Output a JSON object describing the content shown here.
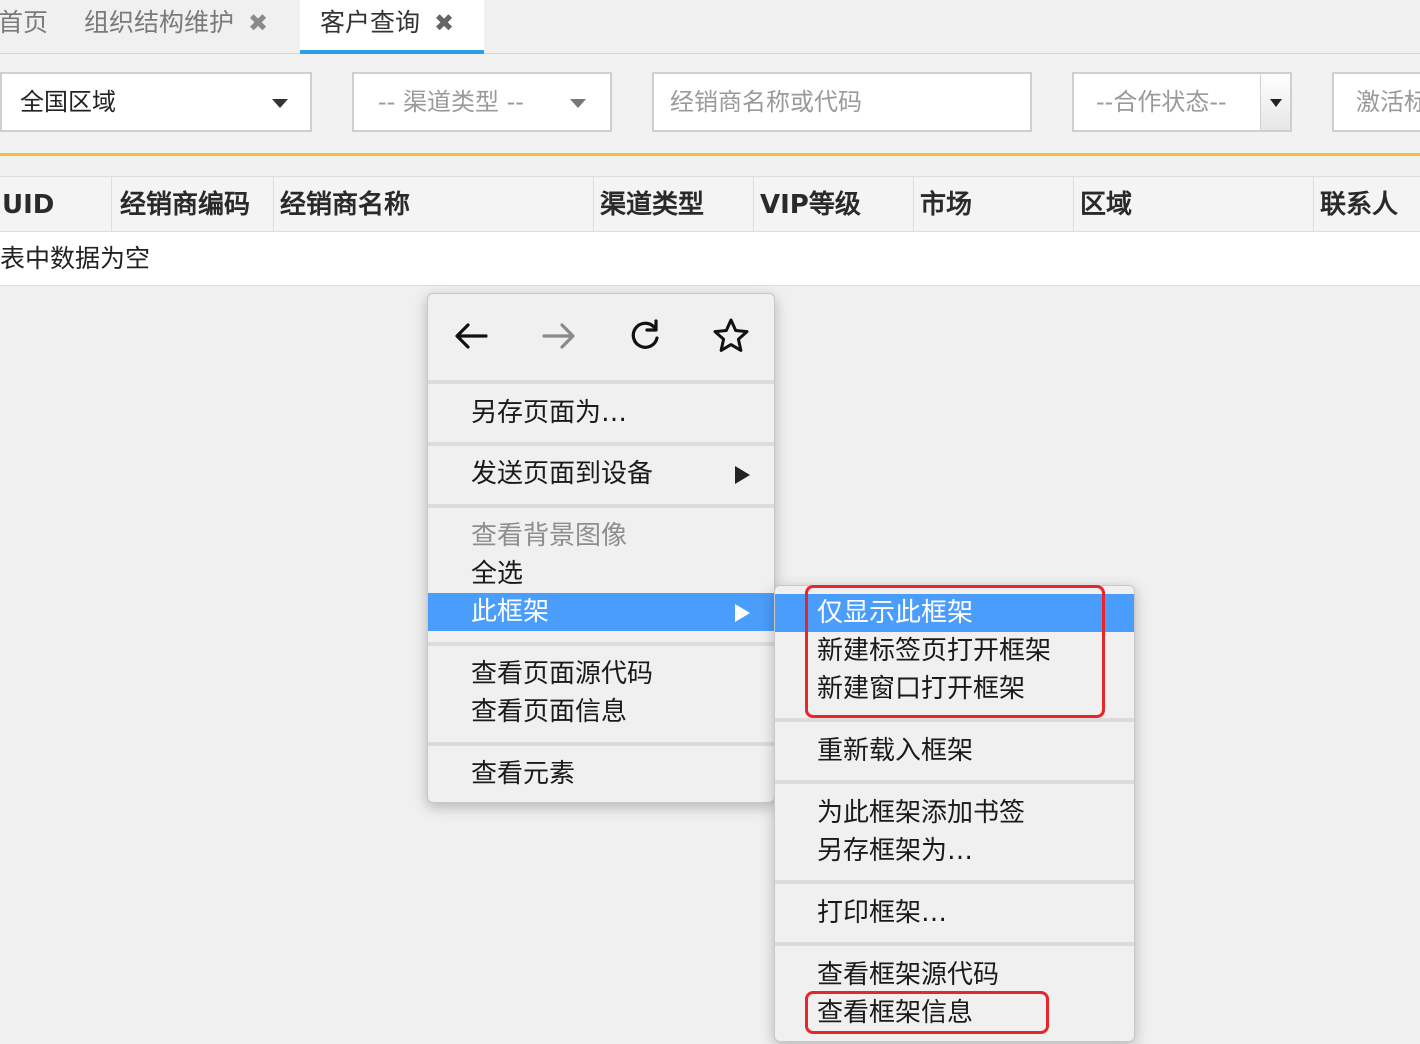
{
  "tabs": [
    {
      "label": "首页",
      "closable": false,
      "active": false
    },
    {
      "label": "组织结构维护",
      "closable": true,
      "active": false
    },
    {
      "label": "客户查询",
      "closable": true,
      "active": true
    }
  ],
  "tab_close_glyph": "✖",
  "filters": {
    "region": {
      "value": "全国区域"
    },
    "channel_type": {
      "placeholder": "-- 渠道类型 --"
    },
    "dealer_search": {
      "placeholder": "经销商名称或代码"
    },
    "cooperation_status": {
      "placeholder": "--合作状态--"
    },
    "activation": {
      "placeholder": "激活标"
    }
  },
  "table": {
    "columns": [
      "UID",
      "经销商编码",
      "经销商名称",
      "渠道类型",
      "VIP等级",
      "市场",
      "区域",
      "联系人"
    ],
    "empty_text": "表中数据为空"
  },
  "context_menu": {
    "nav": {
      "back": "back-arrow-icon",
      "forward": "forward-arrow-icon",
      "reload": "reload-icon",
      "bookmark": "star-icon"
    },
    "items": {
      "save_page_as": "另存页面为…",
      "send_to_device": "发送页面到设备",
      "view_bg_image": "查看背景图像",
      "select_all": "全选",
      "this_frame": "此框架",
      "view_page_source": "查看页面源代码",
      "view_page_info": "查看页面信息",
      "inspect_element": "查看元素"
    }
  },
  "frame_submenu": {
    "show_only_this_frame": "仅显示此框架",
    "open_frame_new_tab": "新建标签页打开框架",
    "open_frame_new_window": "新建窗口打开框架",
    "reload_frame": "重新载入框架",
    "bookmark_frame": "为此框架添加书签",
    "save_frame_as": "另存框架为…",
    "print_frame": "打印框架…",
    "view_frame_source": "查看框架源代码",
    "view_frame_info": "查看框架信息"
  },
  "colors": {
    "highlight": "#4b9dfb",
    "tab_accent": "#2c9ee8",
    "toolbar_divider": "#f5bd3a",
    "annotation_red": "#e8262a"
  }
}
